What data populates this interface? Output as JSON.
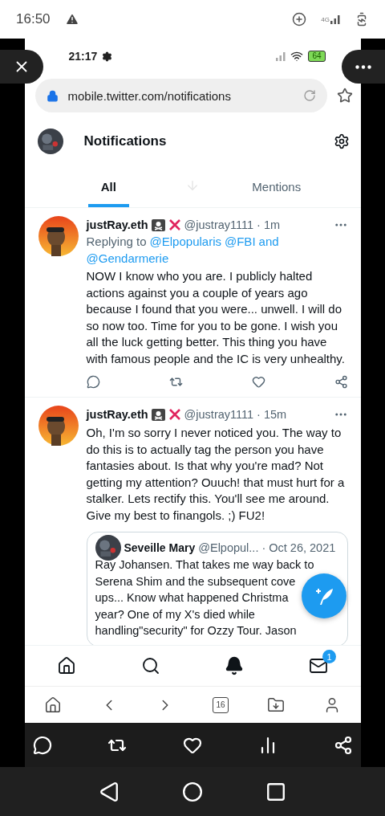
{
  "system_status": {
    "time": "16:50",
    "network": "4G"
  },
  "browser": {
    "status_time": "21:17",
    "battery": "64",
    "url": "mobile.twitter.com/notifications"
  },
  "header": {
    "title": "Notifications"
  },
  "tabs": [
    {
      "label": "All",
      "selected": true
    },
    {
      "label": "Mentions",
      "selected": false
    }
  ],
  "tweets": [
    {
      "name": "justRay.eth",
      "handle": "@justray1111",
      "time": "· 1m",
      "replying_label": "Replying to",
      "mentions": [
        "@Elpopularis",
        "@FBI",
        "and",
        "@Gendarmerie"
      ],
      "text": "NOW I know who you are. I publicly halted actions against you a couple of years ago because I found that you were... unwell. I will do so now too. Time for you to be gone. I wish you all the luck getting better. This thing you have with famous people and the IC is very unhealthy."
    },
    {
      "name": "justRay.eth",
      "handle": "@justray1111",
      "time": "· 15m",
      "text": "Oh, I'm so sorry I never noticed you. The way to do this is to actually tag the person you have fantasies about. Is that why you're mad? Not getting my attention? Ouuch! that must hurt for a stalker. Lets rectify this. You'll see me around. Give my best to finangols. ;) FU2!",
      "quote": {
        "name": "Seveille Mary",
        "handle": "@Elpopul...",
        "date": "· Oct 26, 2021",
        "lines": [
          "Ray Johansen. That takes me way back to",
          "Serena Shim and the subsequent cove",
          "ups... Know what happened Christma",
          "year? One of my X's died while",
          "handling\"security\" for Ozzy Tour. Jason"
        ]
      }
    }
  ],
  "twitter_nav": [
    {
      "kind": "home",
      "selected": false
    },
    {
      "kind": "search",
      "selected": false
    },
    {
      "kind": "notifications",
      "selected": true
    },
    {
      "kind": "messages",
      "selected": false,
      "badge": "1"
    }
  ],
  "browser_nav": [
    {
      "kind": "home"
    },
    {
      "kind": "back"
    },
    {
      "kind": "forward"
    },
    {
      "kind": "tabs",
      "label": "16"
    },
    {
      "kind": "downloads"
    },
    {
      "kind": "profile"
    }
  ],
  "action_bar": [
    {
      "kind": "comment"
    },
    {
      "kind": "retweet"
    },
    {
      "kind": "like"
    },
    {
      "kind": "stats"
    },
    {
      "kind": "share"
    }
  ],
  "system_nav": [
    {
      "kind": "back"
    },
    {
      "kind": "home"
    },
    {
      "kind": "recents"
    }
  ]
}
